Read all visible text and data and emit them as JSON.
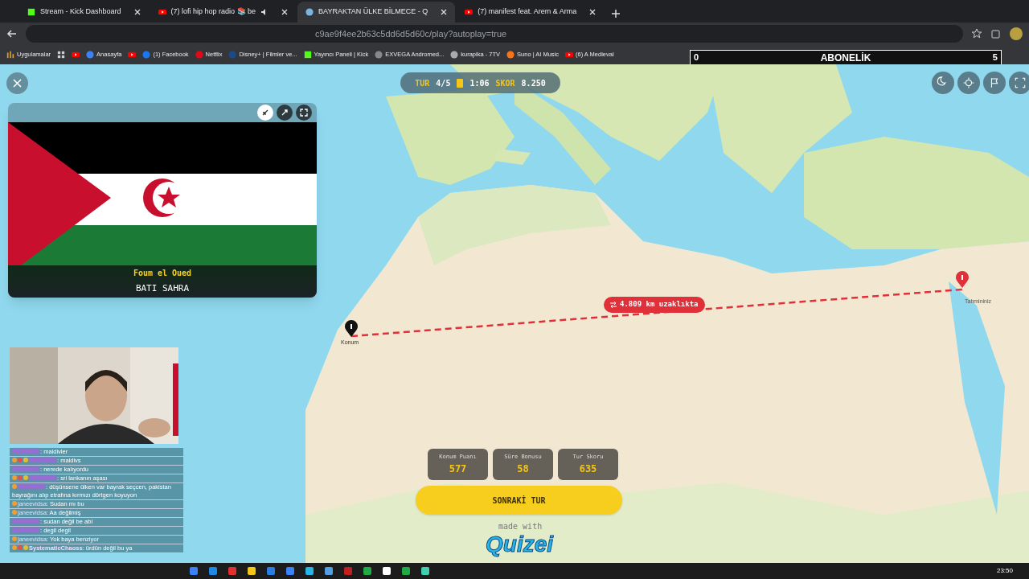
{
  "browser": {
    "tabs": [
      {
        "title": "Stream - Kick Dashboard",
        "selected": false
      },
      {
        "title": "(7) lofi hip hop radio 📚 be",
        "selected": false
      },
      {
        "title": "BAYRAKTAN ÜLKE BİLMECE - Q",
        "selected": true
      },
      {
        "title": "(7) manifest feat. Arem & Arma",
        "selected": false
      }
    ],
    "url": "c9ae9f4ee2b63c5dd6d5d60c/play?autoplay=true",
    "bookmarks": [
      "Uygulamalar",
      "Anasayfa",
      "(1) Facebook",
      "Netflix",
      "Disney+ | Filmler ve...",
      "Yayıncı Paneli | Kick",
      "EXVEGA Andromed...",
      "kurapika - 7TV",
      "Suno | AI Music",
      "(6) A Medieval"
    ]
  },
  "subscription_bar": {
    "title": "ABONELİK",
    "start": "0",
    "goal": "5"
  },
  "game": {
    "hud": {
      "round_label": "TUR",
      "round": "4/5",
      "time": "1:06",
      "score_label": "SKOR",
      "score": "8.250"
    },
    "flag_card": {
      "city": "Foum el Oued",
      "country": "BATI SAHRA"
    },
    "answer_label": "Konum",
    "guess_label": "Tahmininiz",
    "distance": "4.809 km uzaklıkta",
    "scores": [
      {
        "label": "Konum Puanı",
        "value": "577"
      },
      {
        "label": "Süre Bonusu",
        "value": "58"
      },
      {
        "label": "Tur Skoru",
        "value": "635"
      }
    ],
    "next_button": "SONRAKİ TUR",
    "credit": "made with",
    "brand": "Quizei"
  },
  "chat": [
    {
      "text": ": maldivler"
    },
    {
      "text": ": maldivs"
    },
    {
      "text": ": nerede kalıyordu"
    },
    {
      "text": ": sri lankanın aşası"
    },
    {
      "text": ": düşünsene ülken var bayrak seçcen, pakistan bayrağını alıp etrafına kırmızı dörtgen koyuyon"
    },
    {
      "user": "janeevidsa",
      "text": ": Sudan mı bu"
    },
    {
      "user": "janeevidsa",
      "text": ": Aa değilmiş"
    },
    {
      "text": ": sudan değil be abi"
    },
    {
      "text": ": degil degil"
    },
    {
      "user": "janeevidsa",
      "text": ": Yok baya benziyor"
    },
    {
      "user": "SystematicChaoss",
      "text": ": ürdün değil bu ya"
    }
  ],
  "taskbar": {
    "time": "23:50"
  }
}
